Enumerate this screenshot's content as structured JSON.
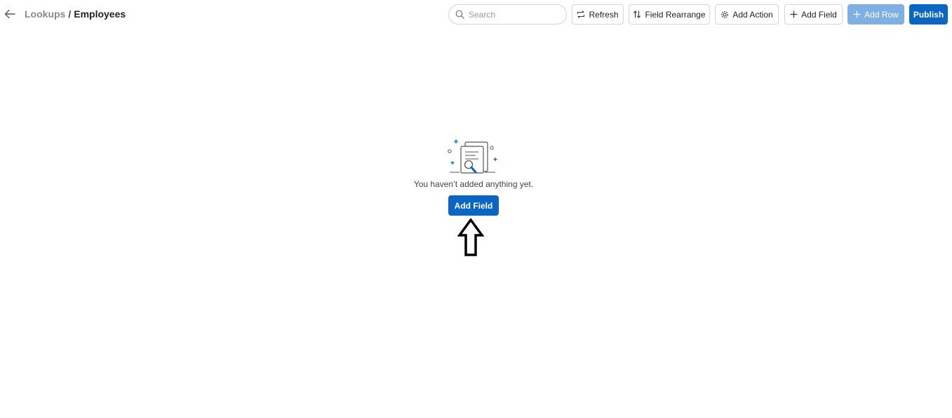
{
  "header": {
    "breadcrumb": {
      "parent": "Lookups",
      "separator": "/",
      "current": "Employees"
    },
    "back_icon": "arrow-left-icon"
  },
  "search": {
    "placeholder": "Search",
    "icon": "search-icon"
  },
  "toolbar": {
    "refresh_label": "Refresh",
    "field_rearrange_label": "Field Rearrange",
    "add_action_label": "Add Action",
    "add_field_label": "Add Field",
    "add_row_label": "Add Row",
    "publish_label": "Publish"
  },
  "empty_state": {
    "message": "You haven’t added anything yet.",
    "add_field_label": "Add Field"
  },
  "colors": {
    "primary": "#0a66c2",
    "primary_disabled": "#7fb0e3",
    "breadcrumb_parent": "#8a8a8a"
  }
}
